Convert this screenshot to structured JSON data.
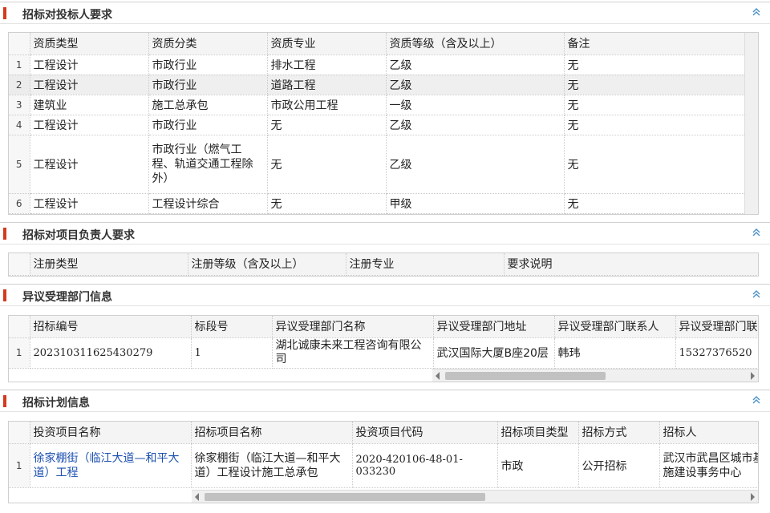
{
  "sections": {
    "bidder": {
      "title": "招标对投标人要求"
    },
    "manager": {
      "title": "招标对项目负责人要求"
    },
    "objection": {
      "title": "异议受理部门信息"
    },
    "plan": {
      "title": "招标计划信息"
    }
  },
  "bidder_table": {
    "headers": [
      "资质类型",
      "资质分类",
      "资质专业",
      "资质等级（含及以上）",
      "备注"
    ],
    "rows": [
      {
        "n": "1",
        "type": "工程设计",
        "category": "市政行业",
        "major": "排水工程",
        "level": "乙级",
        "note": "无"
      },
      {
        "n": "2",
        "type": "工程设计",
        "category": "市政行业",
        "major": "道路工程",
        "level": "乙级",
        "note": "无"
      },
      {
        "n": "3",
        "type": "建筑业",
        "category": "施工总承包",
        "major": "市政公用工程",
        "level": "一级",
        "note": "无"
      },
      {
        "n": "4",
        "type": "工程设计",
        "category": "市政行业",
        "major": "无",
        "level": "乙级",
        "note": "无"
      },
      {
        "n": "5",
        "type": "工程设计",
        "category": "市政行业（燃气工程、轨道交通工程除外）",
        "major": "无",
        "level": "乙级",
        "note": "无"
      },
      {
        "n": "6",
        "type": "工程设计",
        "category": "工程设计综合",
        "major": "无",
        "level": "甲级",
        "note": "无"
      }
    ]
  },
  "manager_table": {
    "headers": [
      "注册类型",
      "注册等级（含及以上）",
      "注册专业",
      "要求说明"
    ]
  },
  "objection_table": {
    "headers": [
      "招标编号",
      "标段号",
      "异议受理部门名称",
      "异议受理部门地址",
      "异议受理部门联系人",
      "异议受理部门联"
    ],
    "rows": [
      {
        "n": "1",
        "code": "202310311625430279",
        "section": "1",
        "dept": "湖北诚康未来工程咨询有限公司",
        "address": "武汉国际大厦B座20层",
        "contact": "韩玮",
        "phone": "15327376520"
      }
    ]
  },
  "plan_table": {
    "headers": [
      "投资项目名称",
      "招标项目名称",
      "投资项目代码",
      "招标项目类型",
      "招标方式",
      "招标人"
    ],
    "rows": [
      {
        "n": "1",
        "invest_name": "徐家棚街（临江大道—和平大道）工程",
        "project_name": "徐家棚街（临江大道—和平大道）工程设计施工总承包",
        "code": "2020-420106-48-01-033230",
        "type": "市政",
        "method": "公开招标",
        "tenderer": "武汉市武昌区城市基设施建设事务中心"
      }
    ]
  },
  "icons": {
    "collapse": "double-chevron-up-icon",
    "accent": "#d33b1f",
    "link_color": "#1a4fb0"
  }
}
